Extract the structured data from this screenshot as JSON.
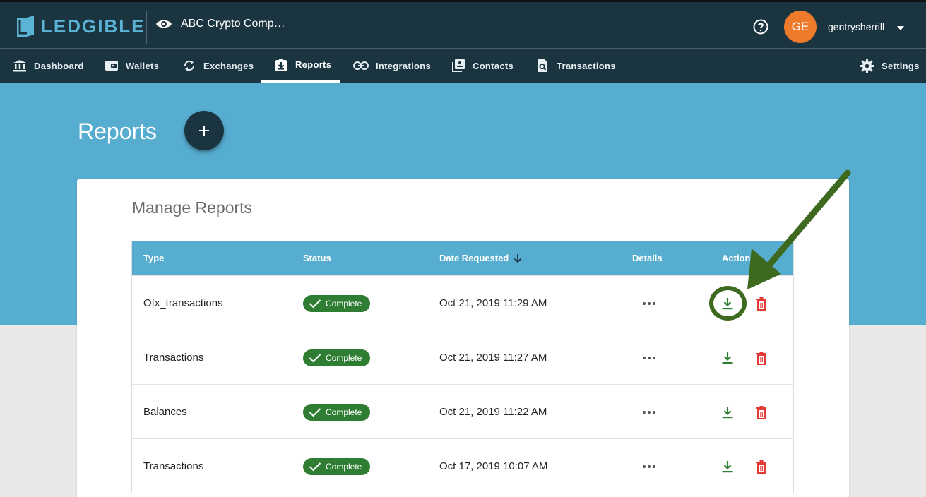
{
  "header": {
    "logo_text": "LEDGIBLE",
    "company_name": "ABC Crypto Comp…",
    "avatar_initials": "GE",
    "username": "gentrysherrill"
  },
  "nav": {
    "items": [
      {
        "label": "Dashboard",
        "icon": "bank-icon"
      },
      {
        "label": "Wallets",
        "icon": "wallet-icon"
      },
      {
        "label": "Exchanges",
        "icon": "sync-icon"
      },
      {
        "label": "Reports",
        "icon": "report-download-icon",
        "active": true
      },
      {
        "label": "Integrations",
        "icon": "link-icon"
      },
      {
        "label": "Contacts",
        "icon": "contacts-icon"
      },
      {
        "label": "Transactions",
        "icon": "transactions-search-icon"
      }
    ],
    "settings_label": "Settings"
  },
  "page": {
    "title": "Reports"
  },
  "card": {
    "title": "Manage Reports",
    "columns": {
      "type": "Type",
      "status": "Status",
      "date": "Date Requested",
      "details": "Details",
      "actions": "Actions"
    },
    "rows": [
      {
        "type": "Ofx_transactions",
        "status": "Complete",
        "date": "Oct 21, 2019 11:29 AM"
      },
      {
        "type": "Transactions",
        "status": "Complete",
        "date": "Oct 21, 2019 11:27 AM"
      },
      {
        "type": "Balances",
        "status": "Complete",
        "date": "Oct 21, 2019 11:22 AM"
      },
      {
        "type": "Transactions",
        "status": "Complete",
        "date": "Oct 17, 2019 10:07 AM"
      }
    ]
  },
  "colors": {
    "topbar": "#1a3440",
    "hero": "#57adcf",
    "avatar": "#ee7a2b",
    "status_complete": "#2e7d32",
    "download": "#2e7d32",
    "delete": "#e53935",
    "annotation": "#3d6a1f"
  }
}
